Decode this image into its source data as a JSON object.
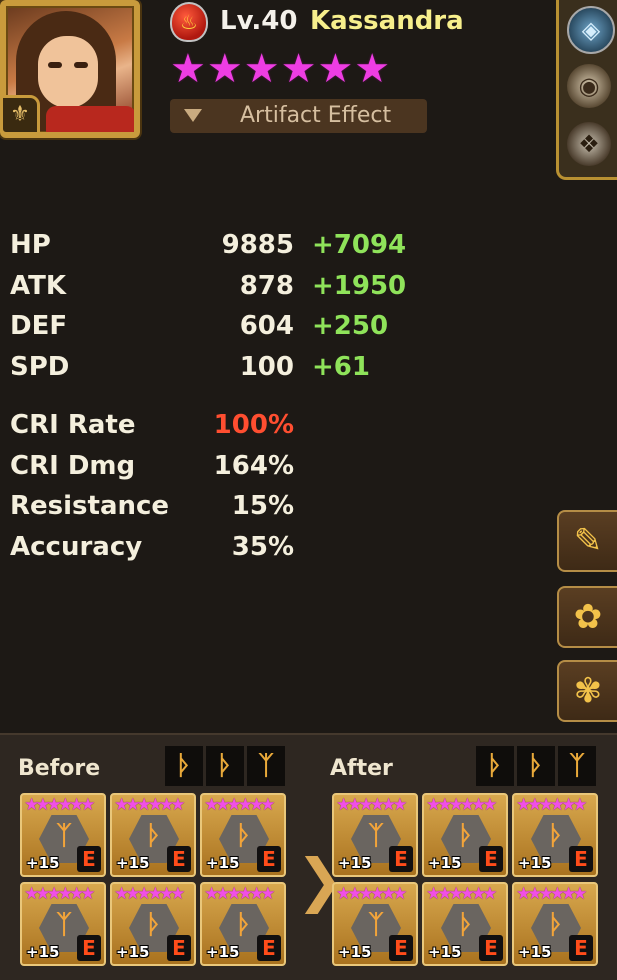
{
  "header": {
    "level": "Lv.40",
    "name": "Kassandra",
    "star_count": 6,
    "artifact_button": "Artifact Effect"
  },
  "stats": {
    "hp": {
      "label": "HP",
      "value": "9885",
      "bonus": "+7094"
    },
    "atk": {
      "label": "ATK",
      "value": "878",
      "bonus": "+1950"
    },
    "def": {
      "label": "DEF",
      "value": "604",
      "bonus": "+250"
    },
    "spd": {
      "label": "SPD",
      "value": "100",
      "bonus": "+61"
    },
    "cri_rate": {
      "label": "CRI Rate",
      "value": "100%"
    },
    "cri_dmg": {
      "label": "CRI Dmg",
      "value": "164%"
    },
    "resistance": {
      "label": "Resistance",
      "value": "15%"
    },
    "accuracy": {
      "label": "Accuracy",
      "value": "35%"
    }
  },
  "rune_compare": {
    "before_label": "Before",
    "after_label": "After",
    "before_runes": [
      {
        "level": "+15",
        "grade": "E",
        "symbol": "ᛉ"
      },
      {
        "level": "+15",
        "grade": "E",
        "symbol": "ᚦ"
      },
      {
        "level": "+15",
        "grade": "E",
        "symbol": "ᚦ"
      },
      {
        "level": "+15",
        "grade": "E",
        "symbol": "ᛉ"
      },
      {
        "level": "+15",
        "grade": "E",
        "symbol": "ᚦ"
      },
      {
        "level": "+15",
        "grade": "E",
        "symbol": "ᚦ"
      }
    ],
    "after_runes": [
      {
        "level": "+15",
        "grade": "E",
        "symbol": "ᛉ"
      },
      {
        "level": "+15",
        "grade": "E",
        "symbol": "ᚦ"
      },
      {
        "level": "+15",
        "grade": "E",
        "symbol": "ᚦ"
      },
      {
        "level": "+15",
        "grade": "E",
        "symbol": "ᛉ"
      },
      {
        "level": "+15",
        "grade": "E",
        "symbol": "ᚦ"
      },
      {
        "level": "+15",
        "grade": "E",
        "symbol": "ᚦ"
      }
    ],
    "set_icons": [
      "ᚦ",
      "ᚦ",
      "ᛉ"
    ]
  },
  "colors": {
    "accent_gold": "#c99b3c",
    "bonus_green": "#8fe35a",
    "crit_red": "#ff4e30"
  }
}
